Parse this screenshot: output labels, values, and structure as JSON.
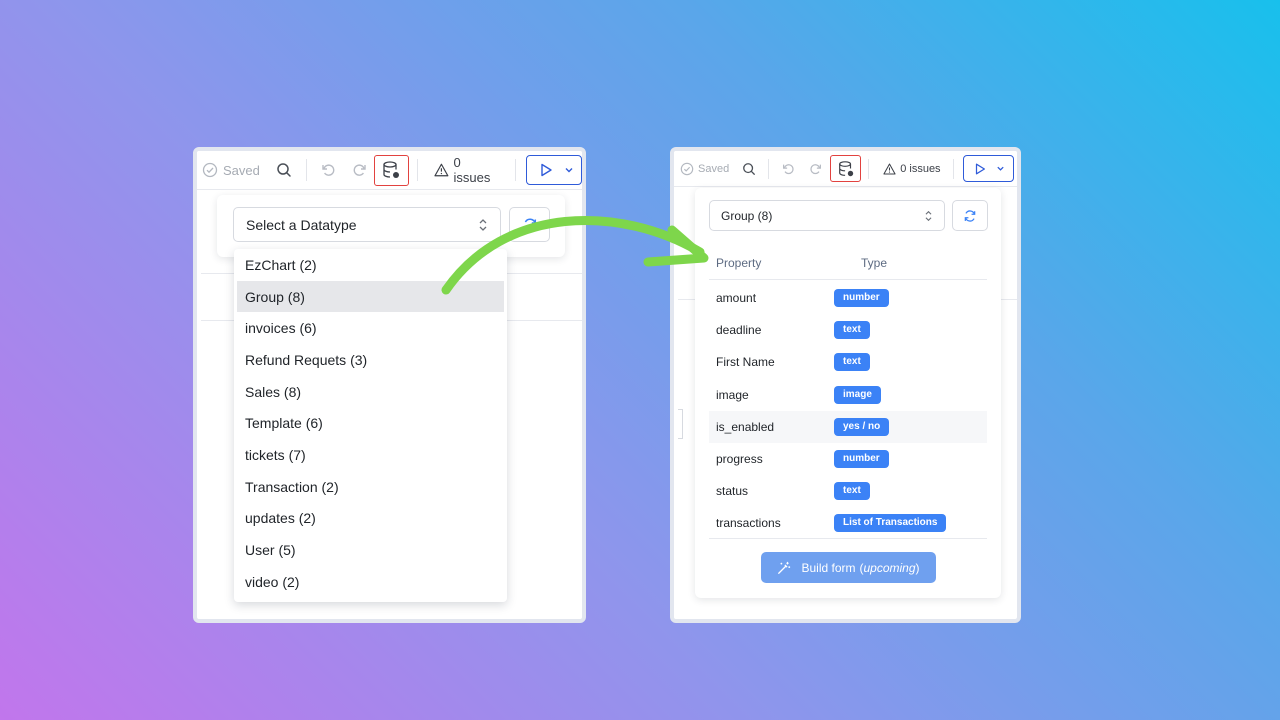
{
  "colors": {
    "accent": "#3b82f6",
    "run": "#2f5bd9",
    "datatype_button_border": "#e2423f",
    "arrow": "#7ed64b"
  },
  "left": {
    "toolbar": {
      "saved_label": "Saved",
      "issues_label": "0 issues"
    },
    "select": {
      "value": "Select a Datatype"
    },
    "dropdown": [
      {
        "label": "EzChart (2)",
        "selected": false
      },
      {
        "label": "Group (8)",
        "selected": true
      },
      {
        "label": "invoices (6)",
        "selected": false
      },
      {
        "label": "Refund Requets (3)",
        "selected": false
      },
      {
        "label": "Sales (8)",
        "selected": false
      },
      {
        "label": "Template (6)",
        "selected": false
      },
      {
        "label": "tickets (7)",
        "selected": false
      },
      {
        "label": "Transaction (2)",
        "selected": false
      },
      {
        "label": "updates (2)",
        "selected": false
      },
      {
        "label": "User (5)",
        "selected": false
      },
      {
        "label": "video (2)",
        "selected": false
      }
    ]
  },
  "right": {
    "toolbar": {
      "saved_label": "Saved",
      "issues_label": "0 issues"
    },
    "select": {
      "value": "Group (8)"
    },
    "headers": {
      "property": "Property",
      "type": "Type"
    },
    "properties": [
      {
        "name": "amount",
        "type": "number"
      },
      {
        "name": "deadline",
        "type": "text"
      },
      {
        "name": "First Name",
        "type": "text"
      },
      {
        "name": "image",
        "type": "image"
      },
      {
        "name": "is_enabled",
        "type": "yes / no"
      },
      {
        "name": "progress",
        "type": "number"
      },
      {
        "name": "status",
        "type": "text"
      },
      {
        "name": "transactions",
        "type": "List of Transactions"
      }
    ],
    "build_button": {
      "label": "Build form",
      "note": "upcoming"
    }
  }
}
